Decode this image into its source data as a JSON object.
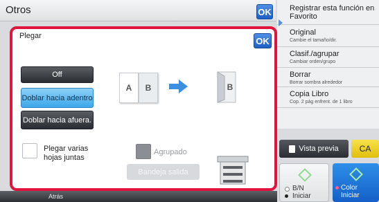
{
  "header": {
    "title": "Otros",
    "ok_label": "OK"
  },
  "menu": {
    "items": [
      {
        "title": "Registrar esta función en Favorito",
        "subtitle": ""
      },
      {
        "title": "Original",
        "subtitle": "Cambie el tamaño/dir."
      },
      {
        "title": "Clasif./agrupar",
        "subtitle": "Cambiar orden/grupo"
      },
      {
        "title": "Borrar",
        "subtitle": "Borrar sombra alrededor"
      },
      {
        "title": "Copia Libro",
        "subtitle": "Cop. 2 pág enfrent. de 1 libro"
      }
    ]
  },
  "panel": {
    "title": "Plegar",
    "ok_label": "OK",
    "options": [
      {
        "label": "Off",
        "selected": false
      },
      {
        "label": "Doblar hacia adentro",
        "selected": true
      },
      {
        "label": "Doblar hacia afuera.",
        "selected": false
      }
    ],
    "illustration": {
      "page_a": "A",
      "page_b": "B",
      "folded": "B"
    },
    "multi_sheet": {
      "label": "Plegar varias hojas juntas",
      "checked": false
    },
    "grouped": {
      "label": "Agrupado",
      "checked": true,
      "enabled": false
    },
    "tray_button": "Bandeja salida"
  },
  "actions": {
    "preview": "Vista previa",
    "ca": "CA",
    "bw_start": {
      "line1": "B/N",
      "line2": "Iniciar"
    },
    "color_start": {
      "line1": "Color",
      "line2": "Iniciar"
    }
  },
  "bottom": {
    "back": "Atrás"
  },
  "colors": {
    "accent_red": "#e0143c",
    "selected_blue": "#3da8ea",
    "ok_blue": "#1e5fc4",
    "ca_yellow": "#f0cf20"
  }
}
